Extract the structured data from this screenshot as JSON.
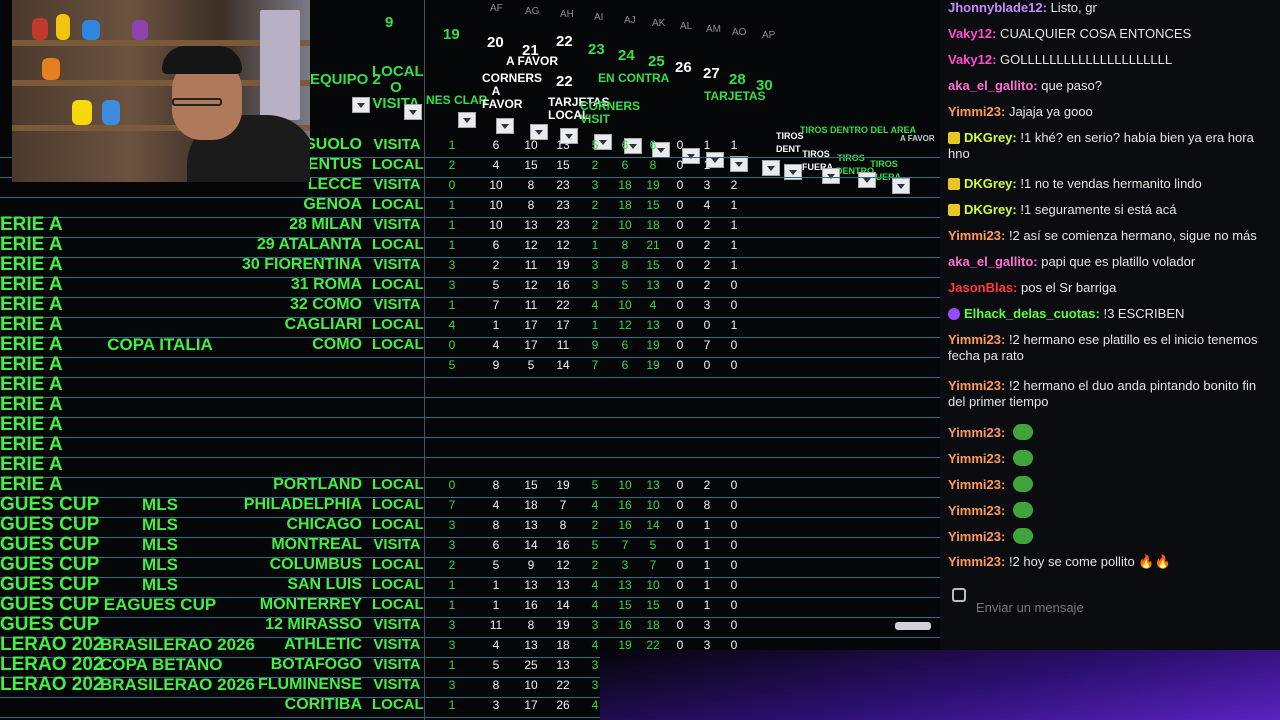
{
  "sheet": {
    "column_letters": [
      "AF",
      "AG",
      "AH",
      "AI",
      "AJ",
      "AK",
      "AL",
      "AM",
      "AO",
      "AP"
    ],
    "headers": {
      "team_col": "EQUIPO 2",
      "local_visit": "LOCAL O VISITA",
      "clean": "NES CLAR",
      "h9": "9",
      "h19": "19",
      "h20": "20",
      "h21": "21",
      "h22a": "22",
      "h22b": "22",
      "h23": "23",
      "h24": "24",
      "h25": "25",
      "h26": "26",
      "h27": "27",
      "h28": "28",
      "h30": "30",
      "a_favor": "A FAVOR",
      "en_contra": "EN CONTRA",
      "tarjetas": "TARJETAS",
      "corners_fav": "CORNERS A FAVOR",
      "tarjetas_local": "TARJETAS LOCAL",
      "corners_visit": "CORNERS VISIT",
      "tiros_dentro_area": "TIROS DENTRO DEL AREA",
      "tiros_dent": "TIROS DENT",
      "tiros_fuera": "TIROS FUERA",
      "tiros_dentro2": "TIROS DENTRO",
      "tiros_fuera2": "TIROS FUERA",
      "a_favor_small": "A FAVOR"
    },
    "rows": [
      {
        "league": "",
        "comp": "",
        "team": "SASSUOLO",
        "lv": "VISITA",
        "nums": [
          "1",
          "6",
          "10",
          "13",
          "5",
          "6",
          "6",
          "0",
          "1",
          "1"
        ]
      },
      {
        "league": "",
        "comp": "",
        "team": "JUVENTUS",
        "lv": "LOCAL",
        "nums": [
          "2",
          "4",
          "15",
          "15",
          "2",
          "6",
          "8",
          "0",
          "1",
          "1"
        ]
      },
      {
        "league": "",
        "comp": "",
        "team": "LECCE",
        "lv": "VISITA",
        "nums": [
          "0",
          "10",
          "8",
          "23",
          "3",
          "18",
          "19",
          "0",
          "3",
          "2"
        ]
      },
      {
        "league": "",
        "comp": "",
        "team": "GENOA",
        "lv": "LOCAL",
        "nums": [
          "1",
          "10",
          "8",
          "23",
          "2",
          "18",
          "15",
          "0",
          "4",
          "1"
        ]
      },
      {
        "league": "ERIE A",
        "comp": "",
        "team": "28 MILAN",
        "lv": "VISITA",
        "nums": [
          "1",
          "10",
          "13",
          "23",
          "2",
          "10",
          "18",
          "0",
          "2",
          "1"
        ]
      },
      {
        "league": "ERIE A",
        "comp": "",
        "team": "29 ATALANTA",
        "lv": "LOCAL",
        "nums": [
          "1",
          "6",
          "12",
          "12",
          "1",
          "8",
          "21",
          "0",
          "2",
          "1"
        ]
      },
      {
        "league": "ERIE A",
        "comp": "",
        "team": "30 FIORENTINA",
        "lv": "VISITA",
        "nums": [
          "3",
          "2",
          "11",
          "19",
          "3",
          "8",
          "15",
          "0",
          "2",
          "1"
        ]
      },
      {
        "league": "ERIE A",
        "comp": "",
        "team": "31 ROMA",
        "lv": "LOCAL",
        "nums": [
          "3",
          "5",
          "12",
          "16",
          "3",
          "5",
          "13",
          "0",
          "2",
          "0"
        ]
      },
      {
        "league": "ERIE A",
        "comp": "",
        "team": "32 COMO",
        "lv": "VISITA",
        "nums": [
          "1",
          "7",
          "11",
          "22",
          "4",
          "10",
          "4",
          "0",
          "3",
          "0"
        ]
      },
      {
        "league": "ERIE A",
        "comp": "",
        "team": "CAGLIARI",
        "lv": "LOCAL",
        "nums": [
          "4",
          "1",
          "17",
          "17",
          "1",
          "12",
          "13",
          "0",
          "0",
          "1"
        ]
      },
      {
        "league": "ERIE A",
        "comp": "COPA ITALIA",
        "team": "COMO",
        "lv": "LOCAL",
        "nums": [
          "0",
          "4",
          "17",
          "11",
          "9",
          "6",
          "19",
          "0",
          "7",
          "0"
        ]
      },
      {
        "league": "ERIE A",
        "comp": "",
        "team": "",
        "lv": "",
        "nums": [
          "5",
          "9",
          "5",
          "14",
          "7",
          "6",
          "19",
          "0",
          "0",
          "0"
        ]
      },
      {
        "league": "ERIE A",
        "comp": "",
        "team": "",
        "lv": "",
        "nums": []
      },
      {
        "league": "ERIE A",
        "comp": "",
        "team": "",
        "lv": "",
        "nums": []
      },
      {
        "league": "ERIE A",
        "comp": "",
        "team": "",
        "lv": "",
        "nums": []
      },
      {
        "league": "ERIE A",
        "comp": "",
        "team": "",
        "lv": "",
        "nums": []
      },
      {
        "league": "ERIE A",
        "comp": "",
        "team": "",
        "lv": "",
        "nums": []
      },
      {
        "league": "ERIE A",
        "comp": "",
        "team": "PORTLAND",
        "lv": "LOCAL",
        "nums": [
          "0",
          "8",
          "15",
          "19",
          "5",
          "10",
          "13",
          "0",
          "2",
          "0"
        ]
      },
      {
        "league": "GUES CUP",
        "comp": "MLS",
        "team": "PHILADELPHIA",
        "lv": "LOCAL",
        "nums": [
          "7",
          "4",
          "18",
          "7",
          "4",
          "16",
          "10",
          "0",
          "8",
          "0"
        ]
      },
      {
        "league": "GUES CUP",
        "comp": "MLS",
        "team": "CHICAGO",
        "lv": "LOCAL",
        "nums": [
          "3",
          "8",
          "13",
          "8",
          "2",
          "16",
          "14",
          "0",
          "1",
          "0"
        ]
      },
      {
        "league": "GUES CUP",
        "comp": "MLS",
        "team": "MONTREAL",
        "lv": "VISITA",
        "nums": [
          "3",
          "6",
          "14",
          "16",
          "5",
          "7",
          "5",
          "0",
          "1",
          "0"
        ]
      },
      {
        "league": "GUES CUP",
        "comp": "MLS",
        "team": "COLUMBUS",
        "lv": "LOCAL",
        "nums": [
          "2",
          "5",
          "9",
          "12",
          "2",
          "3",
          "7",
          "0",
          "1",
          "0"
        ]
      },
      {
        "league": "GUES CUP",
        "comp": "MLS",
        "team": "SAN LUIS",
        "lv": "LOCAL",
        "nums": [
          "1",
          "1",
          "13",
          "13",
          "4",
          "13",
          "10",
          "0",
          "1",
          "0"
        ]
      },
      {
        "league": "GUES CUP",
        "comp": "EAGUES CUP",
        "team": "MONTERREY",
        "lv": "LOCAL",
        "nums": [
          "1",
          "1",
          "16",
          "14",
          "4",
          "15",
          "15",
          "0",
          "1",
          "0"
        ]
      },
      {
        "league": "GUES CUP",
        "comp": "",
        "team": "12 MIRASSO",
        "lv": "VISITA",
        "nums": [
          "3",
          "11",
          "8",
          "19",
          "3",
          "16",
          "18",
          "0",
          "3",
          "0"
        ]
      },
      {
        "league": "LERAO 202",
        "comp": "BRASILERAO 2026",
        "team": "ATHLETIC",
        "lv": "VISITA",
        "nums": [
          "3",
          "4",
          "13",
          "18",
          "4",
          "19",
          "22",
          "0",
          "3",
          "0"
        ]
      },
      {
        "league": "LERAO 202",
        "comp": "COPA BETANO",
        "team": "BOTAFOGO",
        "lv": "VISITA",
        "nums": [
          "1",
          "5",
          "25",
          "13",
          "3",
          "11",
          "18",
          "0",
          "1",
          "0"
        ]
      },
      {
        "league": "LERAO 202",
        "comp": "BRASILERAO 2026",
        "team": "FLUMINENSE",
        "lv": "VISITA",
        "nums": [
          "3",
          "8",
          "10",
          "22",
          "3",
          "9",
          "16",
          "0",
          "2",
          "0"
        ]
      },
      {
        "league": "",
        "comp": "",
        "team": "CORITIBA",
        "lv": "LOCAL",
        "nums": [
          "1",
          "3",
          "17",
          "26",
          "4",
          "13",
          "12",
          "0",
          "1",
          "0"
        ]
      }
    ]
  },
  "chat": {
    "messages": [
      {
        "user": "Jhonnyblade12:",
        "text": "Listo, gr",
        "color": "#c58cff",
        "badge": ""
      },
      {
        "user": "Vaky12:",
        "text": "CUALQUIER COSA ENTONCES",
        "color": "#ff4fd0",
        "badge": ""
      },
      {
        "user": "Vaky12:",
        "text": "GOLLLLLLLLLLLLLLLLLLLLL",
        "color": "#ff4fd0",
        "badge": ""
      },
      {
        "user": "aka_el_gallito:",
        "text": "que paso?",
        "color": "#ff6fd8",
        "badge": ""
      },
      {
        "user": "Yimmi23:",
        "text": "Jajaja ya gooo",
        "color": "#ff9a5a",
        "badge": ""
      },
      {
        "user": "DKGrey:",
        "text": "!1 khé? en serio? había bien ya era hora hno",
        "color": "#d2ff3a",
        "badge": "gold"
      },
      {
        "user": "DKGrey:",
        "text": "!1 no te vendas hermanito lindo",
        "color": "#d2ff3a",
        "badge": "gold"
      },
      {
        "user": "DKGrey:",
        "text": "!1 seguramente si está acá",
        "color": "#d2ff3a",
        "badge": "gold"
      },
      {
        "user": "Yimmi23:",
        "text": "!2 así se comienza hermano, sigue no más",
        "color": "#ff9a5a",
        "badge": ""
      },
      {
        "user": "aka_el_gallito:",
        "text": "papi que es platillo volador",
        "color": "#ff6fd8",
        "badge": ""
      },
      {
        "user": "JasonBlas:",
        "text": "pos el Sr barriga",
        "color": "#ff3b3b",
        "badge": ""
      },
      {
        "user": "Elhack_delas_cuotas:",
        "text": "!3 ESCRIBEN",
        "color": "#5dff3a",
        "badge": "purple"
      },
      {
        "user": "Yimmi23:",
        "text": "!2 hermano ese platillo es el inicio tenemos fecha pa rato",
        "color": "#ff9a5a",
        "badge": ""
      },
      {
        "user": "Yimmi23:",
        "text": "!2 hermano el duo anda pintando bonito fin del primer tiempo",
        "color": "#ff9a5a",
        "badge": ""
      },
      {
        "user": "Yimmi23:",
        "text": "",
        "color": "#ff9a5a",
        "badge": "",
        "emote": true
      },
      {
        "user": "Yimmi23:",
        "text": "",
        "color": "#ff9a5a",
        "badge": "",
        "emote": true
      },
      {
        "user": "Yimmi23:",
        "text": "",
        "color": "#ff9a5a",
        "badge": "",
        "emote": true
      },
      {
        "user": "Yimmi23:",
        "text": "",
        "color": "#ff9a5a",
        "badge": "",
        "emote": true
      },
      {
        "user": "Yimmi23:",
        "text": "",
        "color": "#ff9a5a",
        "badge": "",
        "emote": true
      },
      {
        "user": "Yimmi23:",
        "text": "!2 hoy se come pollito 🔥🔥",
        "color": "#ff9a5a",
        "badge": ""
      }
    ],
    "input_placeholder": "Enviar un mensaje"
  },
  "colors": {
    "accent_green": "#44ef44",
    "grid_blue": "#2a6f8a",
    "chat_bg": "#0b0c0f"
  }
}
